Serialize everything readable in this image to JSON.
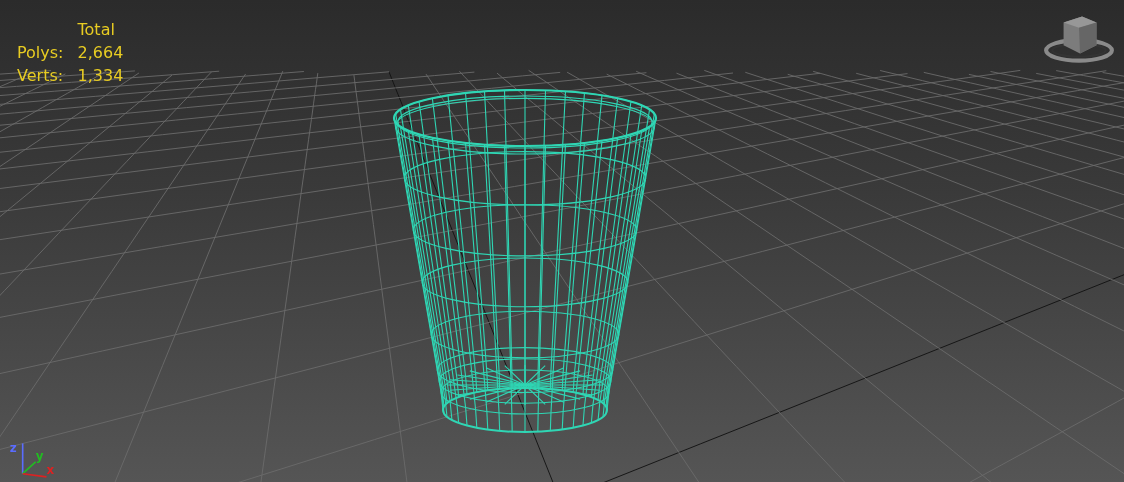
{
  "stats": {
    "header": "Total",
    "rows": [
      {
        "label": "Polys:",
        "value": "2,664"
      },
      {
        "label": "Verts:",
        "value": "1,334"
      }
    ]
  },
  "axes": [
    {
      "label": "z",
      "color": "#5a6cff"
    },
    {
      "label": "y",
      "color": "#22bb22"
    },
    {
      "label": "x",
      "color": "#dd2222"
    }
  ]
}
